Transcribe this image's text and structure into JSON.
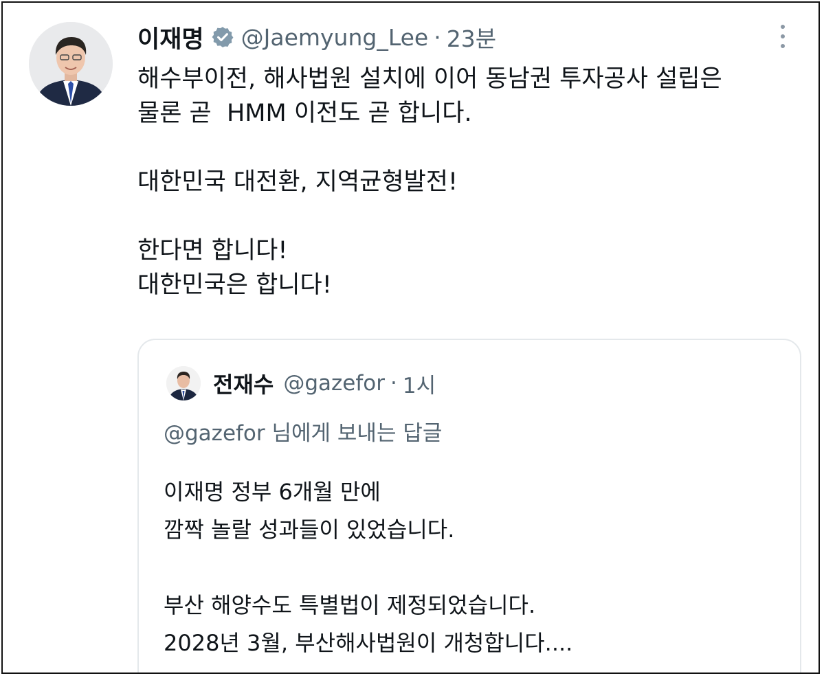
{
  "tweet": {
    "author": {
      "display_name": "이재명",
      "handle": "@Jaemyung_Lee",
      "verified_icon": "verified-badge-icon",
      "avatar": "profile-photo"
    },
    "separator": "·",
    "time": "23분",
    "more_icon": "more-vertical-icon",
    "text_lines": [
      "해수부이전, 해사법원 설치에 이어 동남권 투자공사 설립은",
      "물론 곧  HMM 이전도 곧 합니다.",
      "",
      "대한민국 대전환, 지역균형발전!",
      "",
      "한다면 합니다!",
      "대한민국은 합니다!"
    ]
  },
  "quoted_tweet": {
    "author": {
      "display_name": "전재수",
      "handle": "@gazefor",
      "avatar": "profile-photo"
    },
    "separator": "·",
    "time": "1시",
    "reply_to": "@gazefor 님에게 보내는 답글",
    "text_lines": [
      "이재명 정부 6개월 만에",
      "깜짝 놀랄 성과들이 있었습니다.",
      "",
      "부산 해양수도 특별법이 제정되었습니다.",
      "2028년 3월, 부산해사법원이 개청합니다...."
    ]
  },
  "colors": {
    "text_primary": "#0f1419",
    "text_secondary": "#536471",
    "verified_badge": "#829aab",
    "border": "#e4e8eb"
  }
}
